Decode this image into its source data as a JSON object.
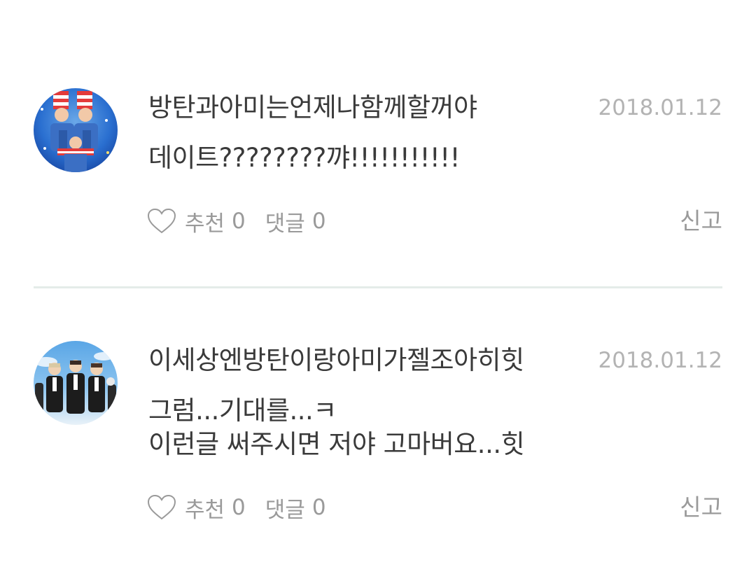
{
  "comments": [
    {
      "author": "방탄과아미는언제나함께할꺼야",
      "date": "2018.01.12",
      "body_lines": [
        "데이트????????꺄!!!!!!!!!!!"
      ],
      "like_label": "추천",
      "like_count": "0",
      "reply_label": "댓글",
      "reply_count": "0",
      "report_label": "신고",
      "avatar_icon": "profile-photo"
    },
    {
      "author": "이세상엔방탄이랑아미가젤조아히힛",
      "date": "2018.01.12",
      "body_lines": [
        "그럼...기대를...ㅋ",
        "이런글 써주시면 저야 고마버요...힛"
      ],
      "like_label": "추천",
      "like_count": "0",
      "reply_label": "댓글",
      "reply_count": "0",
      "report_label": "신고",
      "avatar_icon": "profile-photo"
    }
  ],
  "colors": {
    "text_primary": "#3a3a3a",
    "text_secondary": "#9a9a9a",
    "date": "#b3b3b3",
    "divider": "#e4ece9"
  },
  "icons": {
    "like": "heart-outline-icon"
  }
}
